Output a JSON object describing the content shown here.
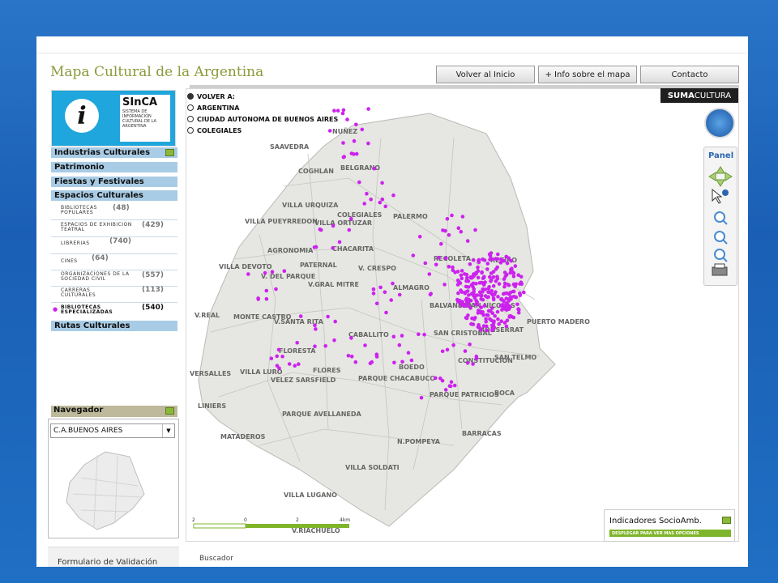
{
  "header": {
    "title": "Mapa Cultural de la Argentina",
    "nav": [
      "Volver al Inicio",
      "+ Info sobre el mapa",
      "Contacto"
    ]
  },
  "logo": {
    "mark": "i",
    "name": "SInCA",
    "subtitle": "SISTEMA DE INFORMACIÓN CULTURAL DE LA ARGENTINA"
  },
  "brand": {
    "bold": "SUMA",
    "rest": "CULTURA"
  },
  "breadcrumb": {
    "label": "VOLVER A:",
    "items": [
      "ARGENTINA",
      "CIUDAD AUTONOMA DE BUENOS AIRES",
      "COLEGIALES"
    ]
  },
  "sidebar": {
    "categories": [
      "Industrias Culturales",
      "Patrimonio",
      "Fiestas y Festivales",
      "Espacios Culturales"
    ],
    "subitems": [
      {
        "label": "BIBLIOTECAS POPULARES",
        "count": "(48)"
      },
      {
        "label": "ESPACIOS DE EXHIBICION TEATRAL",
        "count": "(429)"
      },
      {
        "label": "LIBRERIAS",
        "count": "(740)"
      },
      {
        "label": "CINES",
        "count": "(64)"
      },
      {
        "label": "ORGANIZACIONES DE LA SOCIEDAD CIVIL",
        "count": "(557)"
      },
      {
        "label": "CARRERAS CULTURALES",
        "count": "(113)"
      },
      {
        "label": "BIBLIOTECAS ESPECIALIZADAS",
        "count": "(540)"
      }
    ],
    "last_category": "Rutas Culturales"
  },
  "navigator": {
    "title": "Navegador",
    "select_value": "C.A.BUENOS AIRES"
  },
  "panel": {
    "title": "Panel"
  },
  "indicators": {
    "title": "Indicadores SocioAmb.",
    "action": "DESPLEGAR PARA VER MAS OPCIONES"
  },
  "scale": {
    "labels": [
      "2",
      "0",
      "2",
      "4km"
    ]
  },
  "footer": {
    "search": "Buscador",
    "form": "Formulario de Validación"
  },
  "map": {
    "barrios": [
      "SAAVEDRA",
      "NUÑEZ",
      "COGHLAN",
      "BELGRANO",
      "VILLA URQUIZA",
      "COLEGIALES",
      "PALERMO",
      "VILLA PUEYRREDON",
      "VILLA ORTUZAR",
      "AGRONOMIA",
      "CHACARITA",
      "PATERNAL",
      "V. CRESPO",
      "RECOLETA",
      "RETIRO",
      "VILLA DEVOTO",
      "V. DEL PARQUE",
      "V.GRAL MITRE",
      "ALMAGRO",
      "BALVANERA",
      "SAN NICOLAS",
      "V.REAL",
      "MONTE CASTRO",
      "V.SANTA RITA",
      "FLORESTA",
      "CABALLITO",
      "SAN CRISTOBAL",
      "MONSERRAT",
      "PUERTO MADERO",
      "VERSALLES",
      "VILLA LURO",
      "VELEZ SARSFIELD",
      "FLORES",
      "BOEDO",
      "CONSTITUCION",
      "SAN TELMO",
      "LINIERS",
      "PARQUE CHACABUCO",
      "PARQUE PATRICIOS",
      "BOCA",
      "MATADEROS",
      "PARQUE AVELLANEDA",
      "N.POMPEYA",
      "BARRACAS",
      "VILLA SOLDATI",
      "VILLA LUGANO",
      "V.RIACHUELO"
    ],
    "point_color": "#cc22ee"
  },
  "colors": {
    "title": "#8a9a3a",
    "category": "#a9cce6",
    "toggle": "#8ab83a",
    "logo_bg": "#1fa6dc"
  }
}
